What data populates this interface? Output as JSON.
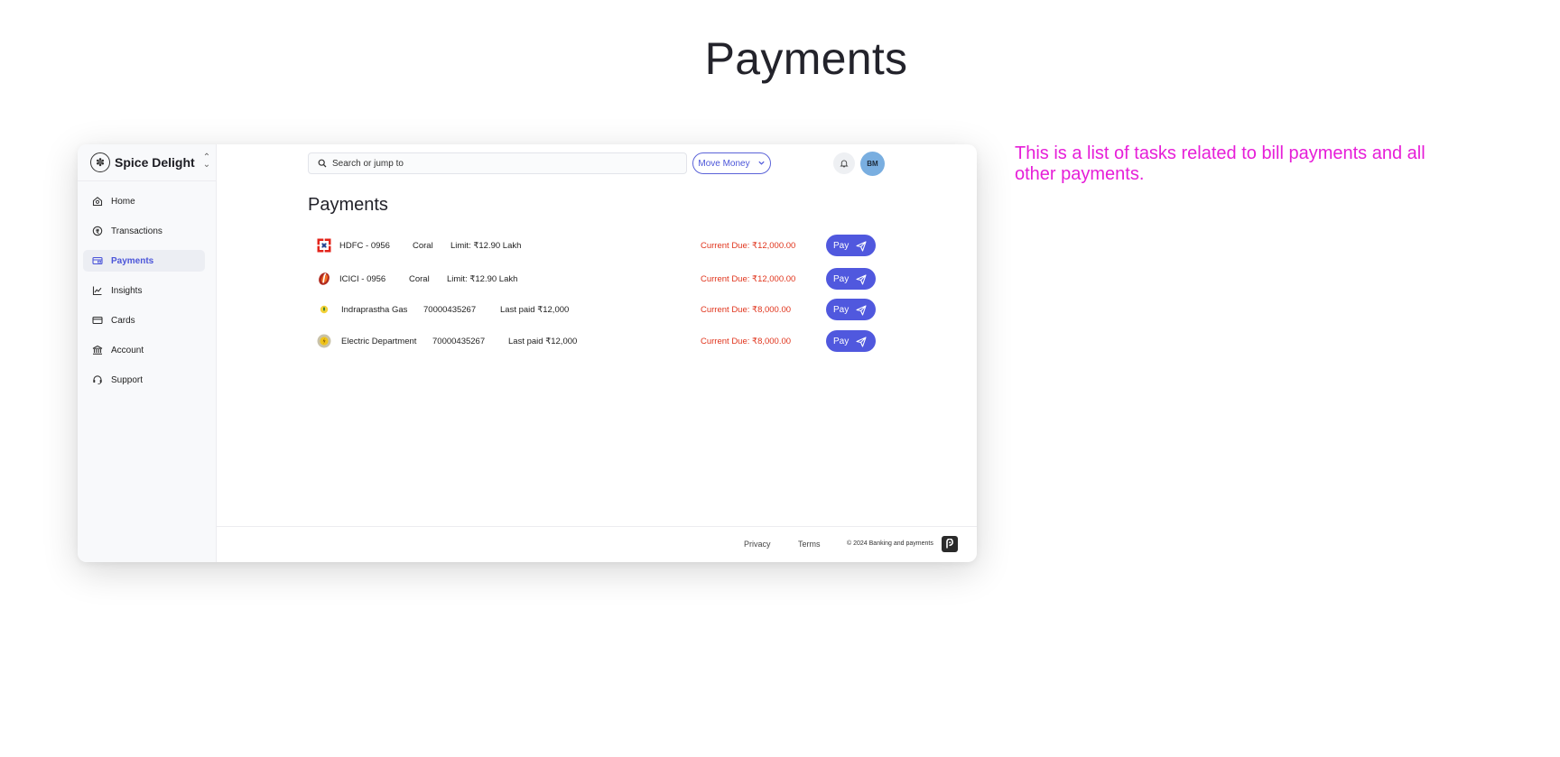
{
  "page": {
    "title": "Payments",
    "annotation": "This is a list of tasks related to bill payments and all other payments."
  },
  "sidebar": {
    "brand": "Spice Delight",
    "items": [
      {
        "label": "Home",
        "icon": "home-icon",
        "active": false
      },
      {
        "label": "Transactions",
        "icon": "transactions-icon",
        "active": false
      },
      {
        "label": "Payments",
        "icon": "payments-icon",
        "active": true
      },
      {
        "label": "Insights",
        "icon": "insights-icon",
        "active": false
      },
      {
        "label": "Cards",
        "icon": "cards-icon",
        "active": false
      },
      {
        "label": "Account",
        "icon": "bank-icon",
        "active": false
      },
      {
        "label": "Support",
        "icon": "support-icon",
        "active": false
      }
    ]
  },
  "topbar": {
    "search_placeholder": "Search or jump to",
    "move_money": "Move Money",
    "avatar_initials": "BM"
  },
  "main": {
    "title": "Payments",
    "pay_label": "Pay",
    "rows": [
      {
        "name": "HDFC - 0956",
        "meta": "Coral",
        "extra": "Limit: ₹12.90 Lakh",
        "due": "Current Due: ₹12,000.00",
        "logo": "hdfc-logo"
      },
      {
        "name": "ICICI - 0956",
        "meta": "Coral",
        "extra": "Limit: ₹12.90 Lakh",
        "due": "Current Due: ₹12,000.00",
        "logo": "icici-logo"
      },
      {
        "name": "Indraprastha Gas",
        "meta": "70000435267",
        "extra": "Last paid  ₹12,000",
        "due": "Current Due: ₹8,000.00",
        "logo": "gas-logo"
      },
      {
        "name": "Electric Department",
        "meta": "70000435267",
        "extra": "Last paid  ₹12,000",
        "due": "Current Due: ₹8,000.00",
        "logo": "electric-logo"
      }
    ]
  },
  "footer": {
    "privacy": "Privacy",
    "terms": "Terms",
    "copyright": "2024 Banking and payments",
    "copyright_symbol": "©"
  },
  "colors": {
    "accent": "#5058de",
    "due": "#e0341c",
    "annotation": "#e61ed8"
  }
}
